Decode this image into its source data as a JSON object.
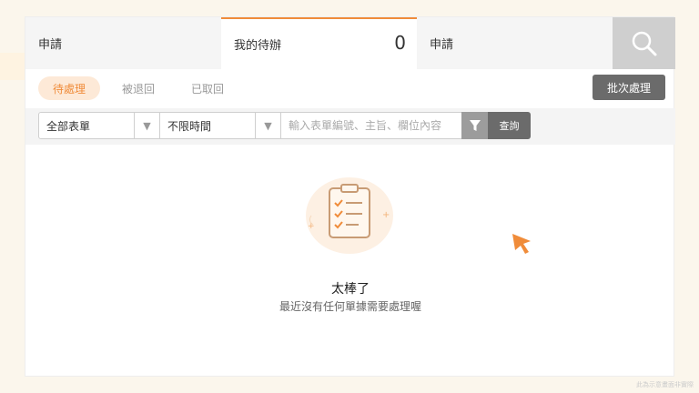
{
  "tabs": {
    "apply_left": "申請",
    "todo": "我的待辦",
    "todo_count": "0",
    "apply_right": "申請"
  },
  "subtabs": [
    {
      "label": "待處理",
      "active": true
    },
    {
      "label": "被退回",
      "active": false
    },
    {
      "label": "已取回",
      "active": false
    }
  ],
  "batch_button": "批次處理",
  "filters": {
    "form_select": "全部表單",
    "time_select": "不限時間",
    "search_placeholder": "輸入表單編號、主旨、欄位內容",
    "query_button": "查詢"
  },
  "empty_state": {
    "title": "太棒了",
    "subtitle": "最近沒有任何單據需要處理喔"
  },
  "watermark": "此為示意畫面非實際",
  "colors": {
    "accent": "#f08c3a",
    "accent_light": "#fde9d7",
    "button_dark": "#6b6b6b",
    "search_tab_bg": "#cfcfcf"
  },
  "icons": {
    "search": "search-icon",
    "filter": "filter-icon",
    "dropdown": "chevron-down-icon",
    "empty": "clipboard-checklist-icon",
    "cursor": "pointer-arrow-icon"
  }
}
